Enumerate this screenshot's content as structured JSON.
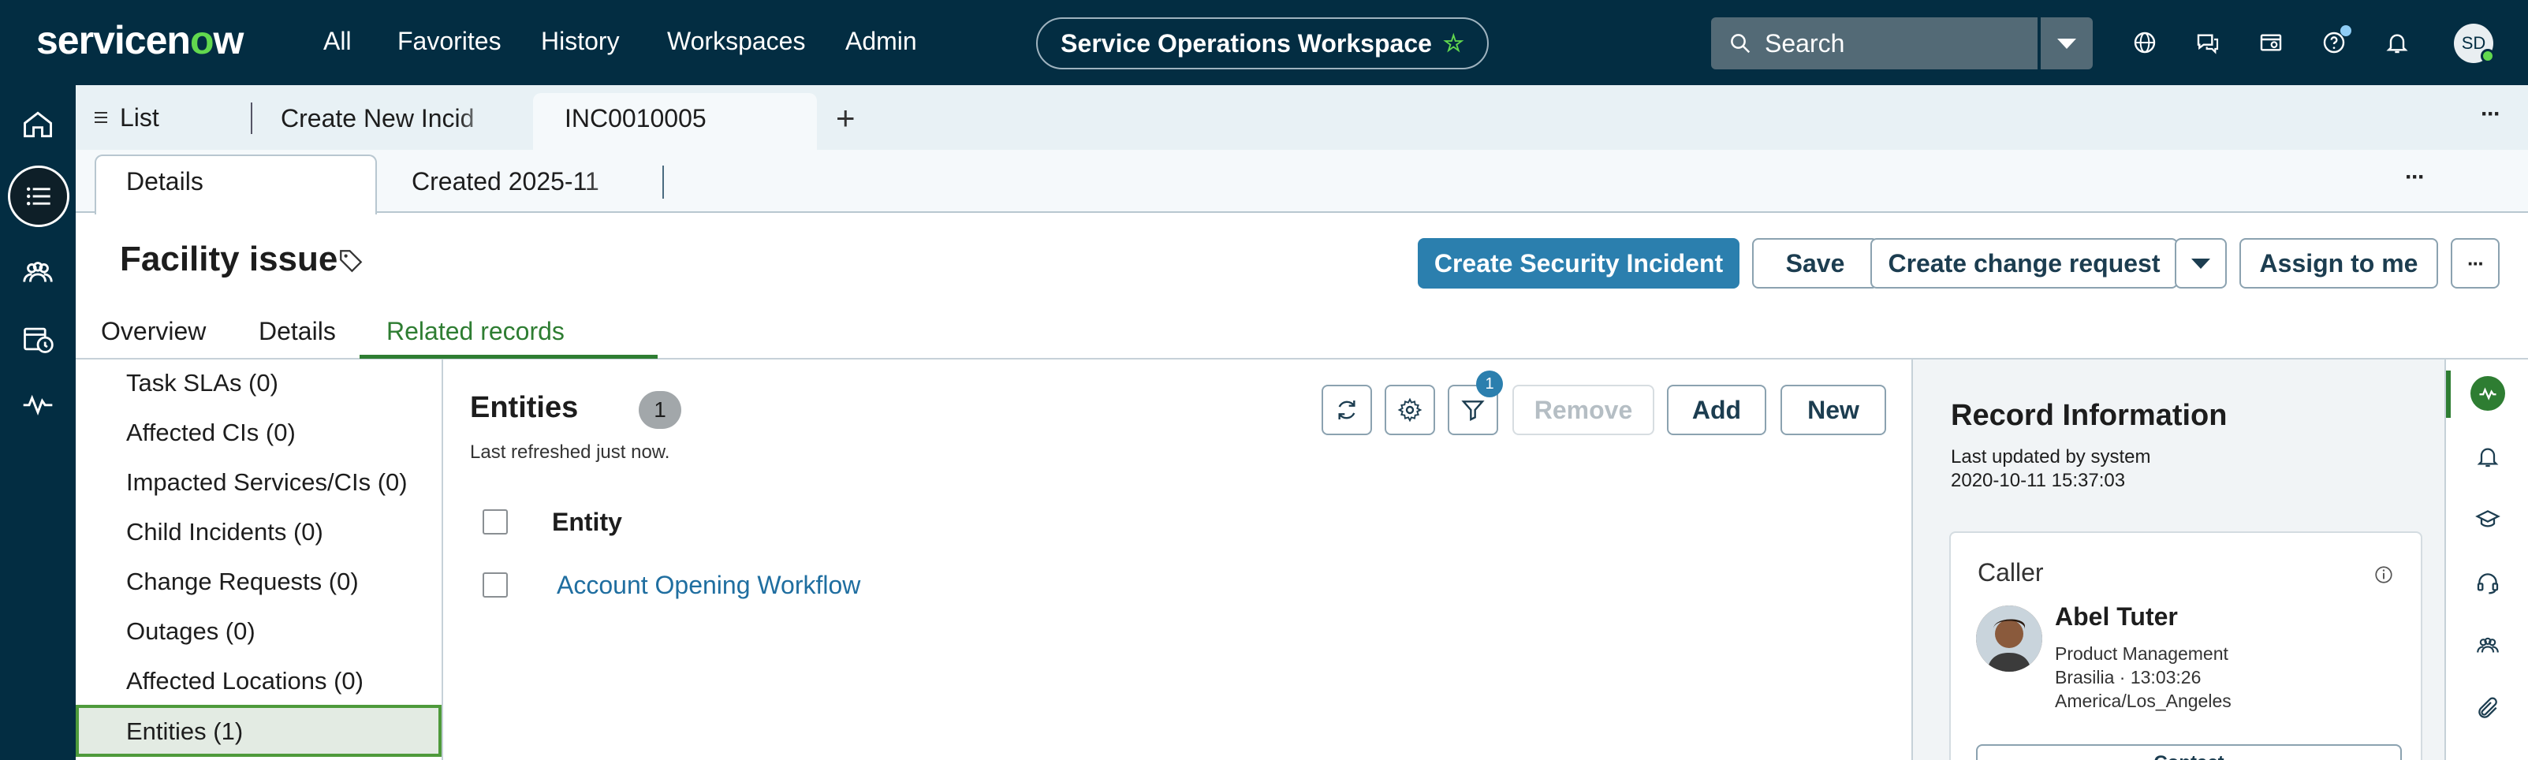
{
  "header": {
    "logo_text": "servicenow",
    "nav": [
      "All",
      "Favorites",
      "History",
      "Workspaces",
      "Admin"
    ],
    "workspace_title": "Service Operations Workspace",
    "search_placeholder": "Search",
    "user_initials": "SD",
    "icons": [
      "globe-icon",
      "chat-icon",
      "connect-icon",
      "help-icon",
      "bell-icon"
    ]
  },
  "rail": {
    "items": [
      "home-icon",
      "list-icon",
      "groups-icon",
      "schedule-icon",
      "activity-icon"
    ],
    "active": "list-icon"
  },
  "tabs": {
    "list_label": "List",
    "create_label": "Create New Incid",
    "active_label": "INC0010005"
  },
  "subtabs": {
    "details_label": "Details",
    "created_label": "Created 2025-11"
  },
  "record": {
    "title": "Facility issue",
    "buttons": {
      "create_security": "Create Security Incident",
      "save": "Save",
      "create_change": "Create change request",
      "assign": "Assign to me"
    },
    "form_tabs": [
      "Overview",
      "Details",
      "Related records"
    ],
    "active_form_tab": "Related records"
  },
  "related": {
    "items": [
      "Task SLAs (0)",
      "Affected CIs (0)",
      "Impacted Services/CIs (0)",
      "Child Incidents (0)",
      "Change Requests (0)",
      "Outages (0)",
      "Affected Locations (0)",
      "Entities (1)"
    ],
    "selected": "Entities (1)"
  },
  "entities": {
    "title": "Entities",
    "count": "1",
    "refreshed": "Last refreshed just now.",
    "filter_badge": "1",
    "buttons": {
      "remove": "Remove",
      "add": "Add",
      "new": "New"
    },
    "column": "Entity",
    "rows": [
      "Account Opening Workflow"
    ]
  },
  "record_info": {
    "title": "Record Information",
    "updated_by": "Last updated by system",
    "updated_at": "2020-10-11 15:37:03",
    "caller": {
      "label": "Caller",
      "name": "Abel Tuter",
      "department": "Product Management",
      "location_time": "Brasilia · 13:03:26",
      "timezone": "America/Los_Angeles",
      "contact_label": "Contact"
    }
  },
  "utility_rail": {
    "items": [
      "agent-assist-icon",
      "notification-icon",
      "learning-icon",
      "headset-icon",
      "people-icon",
      "attachment-icon"
    ]
  },
  "colors": {
    "header_bg": "#032d42",
    "brand_green": "#62d84e",
    "primary_button": "#2b7fae",
    "active_tab_green": "#2e7d32",
    "link": "#1f6ea0"
  }
}
